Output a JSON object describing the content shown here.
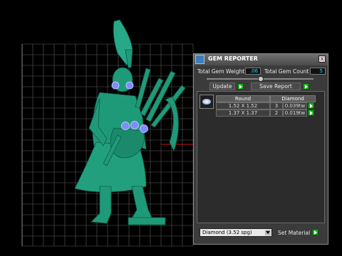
{
  "panel": {
    "title": "GEM REPORTER",
    "close_label": "x",
    "total_gem_weight_label": "Total Gem Weight",
    "total_gem_weight_value": ".06",
    "total_gem_count_label": "Total Gem Count",
    "total_gem_count_value": "5",
    "update_label": "Update",
    "save_report_label": "Save Report",
    "table": {
      "headers": [
        "Round",
        "Diamond"
      ],
      "rows": [
        {
          "size": "1.52 X 1.52",
          "count": "3",
          "weight": "0.039tw"
        },
        {
          "size": "1.37 X 1.37",
          "count": "2",
          "weight": "0.019tw"
        }
      ]
    },
    "material_value": "Diamond    (3.52 spg)",
    "set_material_label": "Set Material"
  },
  "colors": {
    "model": "#1f9a78",
    "gem": "#7f8cff",
    "accent_go": "#1faa1f",
    "value_text": "#00e5ff"
  }
}
